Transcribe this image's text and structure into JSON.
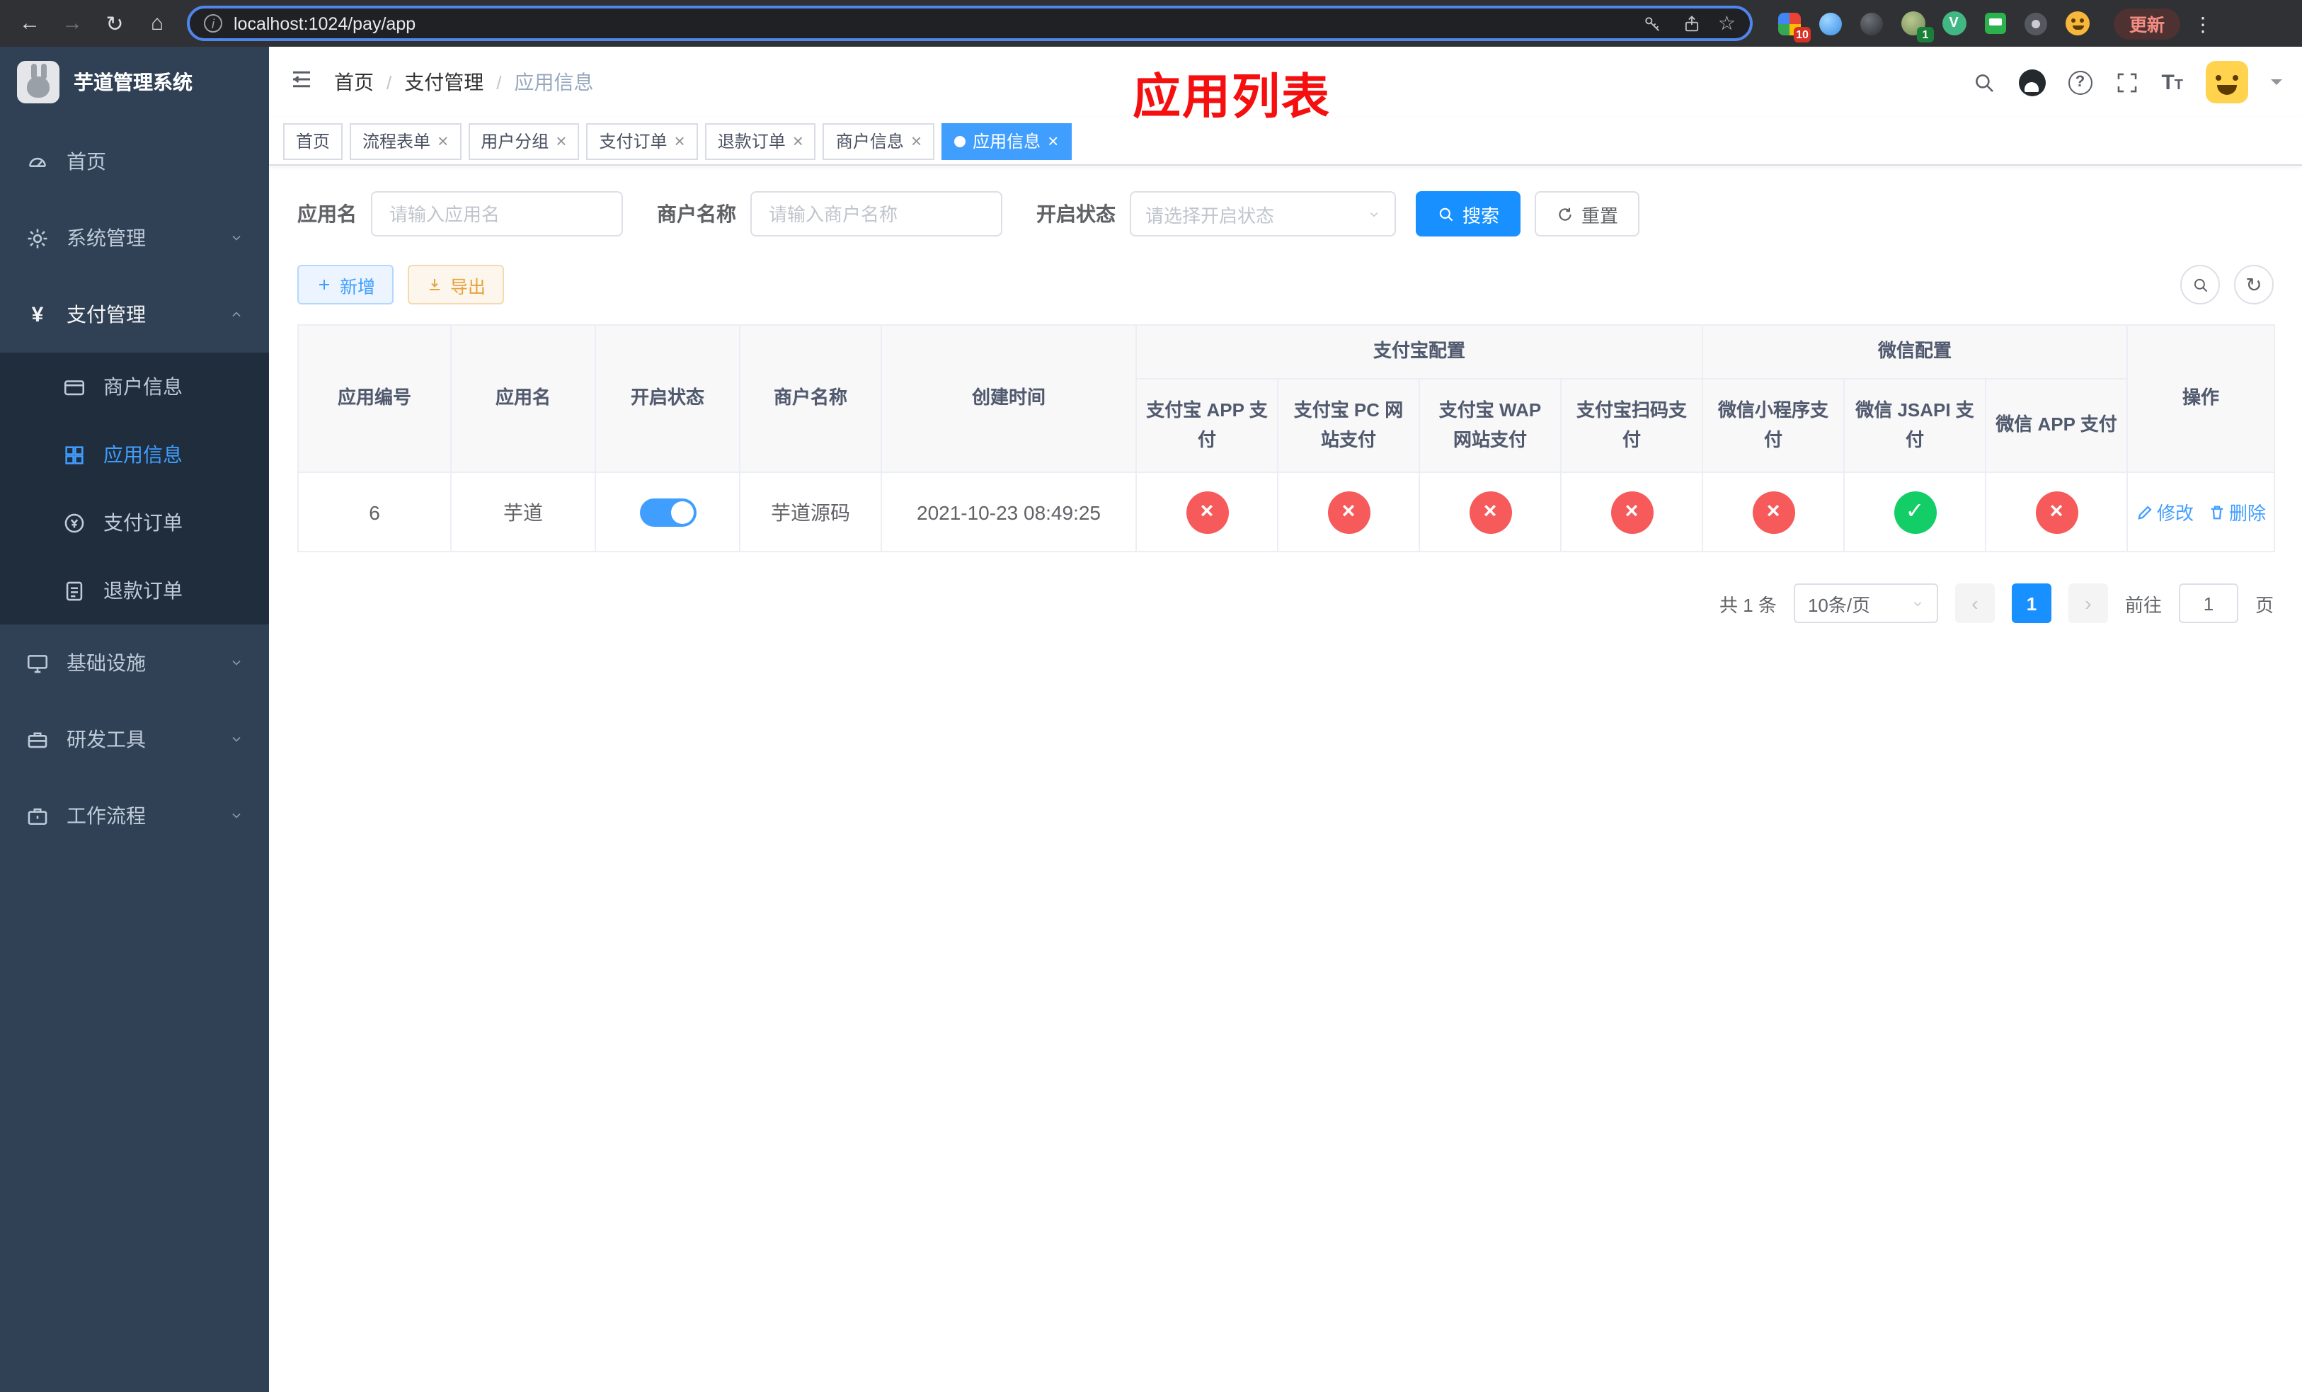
{
  "browser": {
    "url": "localhost:1024/pay/app",
    "update_label": "更新",
    "ext_badge_primary": "10",
    "ext_badge_avatar": "1"
  },
  "overlay": {
    "title": "应用列表"
  },
  "sidebar": {
    "title": "芋道管理系统",
    "items": [
      {
        "label": "首页"
      },
      {
        "label": "系统管理"
      },
      {
        "label": "支付管理",
        "children": [
          {
            "label": "商户信息"
          },
          {
            "label": "应用信息",
            "active": true
          },
          {
            "label": "支付订单"
          },
          {
            "label": "退款订单"
          }
        ]
      },
      {
        "label": "基础设施"
      },
      {
        "label": "研发工具"
      },
      {
        "label": "工作流程"
      }
    ]
  },
  "navbar": {
    "breadcrumb": [
      "首页",
      "支付管理",
      "应用信息"
    ]
  },
  "tags": [
    {
      "label": "首页",
      "closable": false
    },
    {
      "label": "流程表单",
      "closable": true
    },
    {
      "label": "用户分组",
      "closable": true
    },
    {
      "label": "支付订单",
      "closable": true
    },
    {
      "label": "退款订单",
      "closable": true
    },
    {
      "label": "商户信息",
      "closable": true
    },
    {
      "label": "应用信息",
      "closable": true,
      "active": true
    }
  ],
  "filters": {
    "app_name_label": "应用名",
    "app_name_placeholder": "请输入应用名",
    "merchant_label": "商户名称",
    "merchant_placeholder": "请输入商户名称",
    "status_label": "开启状态",
    "status_placeholder": "请选择开启状态",
    "search_label": "搜索",
    "reset_label": "重置"
  },
  "toolbar": {
    "add_label": "新增",
    "export_label": "导出"
  },
  "table": {
    "group_alipay": "支付宝配置",
    "group_wechat": "微信配置",
    "cols": {
      "app_id": "应用编号",
      "app_name": "应用名",
      "status": "开启状态",
      "merchant": "商户名称",
      "created": "创建时间",
      "alipay_app": "支付宝 APP 支付",
      "alipay_pc": "支付宝 PC 网站支付",
      "alipay_wap": "支付宝 WAP 网站支付",
      "alipay_qr": "支付宝扫码支付",
      "wx_lite": "微信小程序支付",
      "wx_jsapi": "微信 JSAPI 支付",
      "wx_app": "微信 APP 支付",
      "action": "操作"
    },
    "row": {
      "app_id": "6",
      "app_name": "芋道",
      "status_on": true,
      "merchant": "芋道源码",
      "created": "2021-10-23 08:49:25",
      "channels": {
        "alipay_app": false,
        "alipay_pc": false,
        "alipay_wap": false,
        "alipay_qr": false,
        "wx_lite": false,
        "wx_jsapi": true,
        "wx_app": false
      },
      "edit_label": "修改",
      "delete_label": "删除"
    }
  },
  "pagination": {
    "total": "共 1 条",
    "page_size": "10条/页",
    "current_page": "1",
    "goto_label": "前往",
    "goto_value": "1",
    "page_unit": "页"
  },
  "colors": {
    "primary": "#409eff",
    "button_blue": "#1890ff",
    "danger": "#f65a5a",
    "success": "#13ce66",
    "warning": "#e6a23c",
    "sidebar_bg": "#304156",
    "submenu_bg": "#1f2d3d",
    "tag_active": "#409eff",
    "annotation_red": "#f50f0f"
  }
}
